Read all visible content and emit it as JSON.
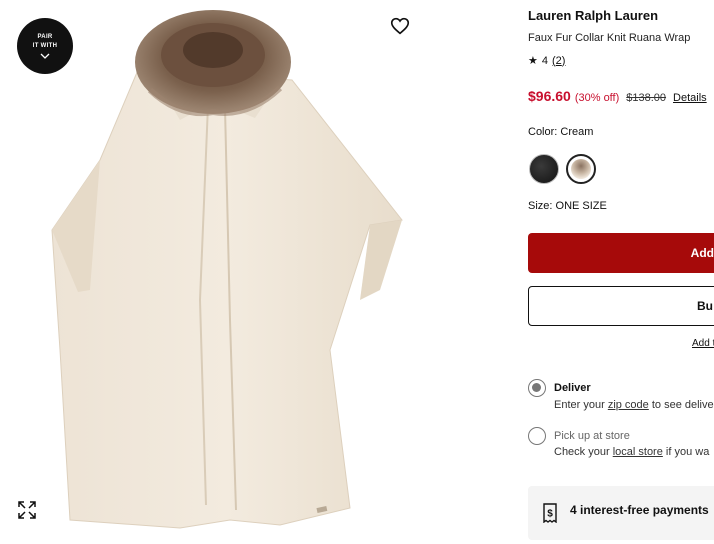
{
  "gallery": {
    "pair_line1": "PAIR",
    "pair_line2": "IT WITH",
    "icons": {
      "wishlist": "heart-icon",
      "expand": "expand-icon",
      "pair": "chevron-down-icon"
    }
  },
  "product": {
    "brand": "Lauren Ralph Lauren",
    "name": "Faux Fur Collar Knit Ruana Wrap",
    "rating_value": "4",
    "rating_count": "2",
    "sale_price": "$96.60",
    "discount": "(30% off)",
    "original_price": "$138.00",
    "details_link": "Details",
    "color_label": "Color: Cream",
    "swatches": [
      {
        "name": "Black",
        "color": "#1a1a1a"
      },
      {
        "name": "Cream",
        "color": "#efe6db",
        "selected": true
      }
    ],
    "size_label": "Size: ONE SIZE"
  },
  "actions": {
    "add_label": "Add",
    "buy_label": "Bu",
    "add_link": "Add t"
  },
  "fulfillment": {
    "deliver_title": "Deliver",
    "deliver_prefix": "Enter your ",
    "deliver_link": "zip code",
    "deliver_suffix": " to see delive",
    "pickup_title": "Pick up at store",
    "pickup_prefix": "Check your ",
    "pickup_link": "local store",
    "pickup_suffix": " if you wa"
  },
  "payment": {
    "text": "4 interest-free payments",
    "icon": "dollar-receipt-icon"
  },
  "colors": {
    "sale_red": "#c8102e",
    "button_red": "#a60a0a"
  }
}
